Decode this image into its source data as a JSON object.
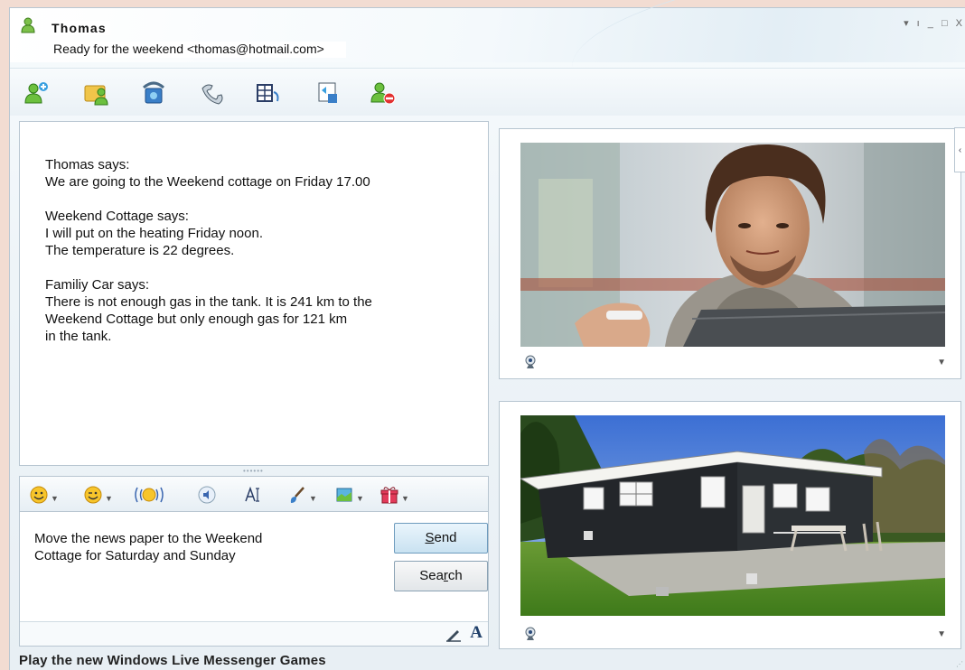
{
  "header": {
    "user_name": "Thomas",
    "status_line": "Ready for the weekend <thomas@hotmail.com>",
    "window_controls": "▾ ı _ □ X"
  },
  "toolbar": {
    "icons": [
      "add-contact-icon",
      "invite-icon",
      "call-icon",
      "phone-icon",
      "video-clip-icon",
      "share-folder-icon",
      "block-icon"
    ]
  },
  "conversation": {
    "messages": [
      {
        "sender": "Thomas says:",
        "text": "We are going to the Weekend cottage on Friday 17.00"
      },
      {
        "sender": "Weekend Cottage says:",
        "text": "I will put on the heating Friday noon.\nThe temperature is 22 degrees."
      },
      {
        "sender": "Familiy Car says:",
        "text": "There is not enough gas in the tank. It is 241 km to the\nWeekend Cottage but only enough gas for 121 km\nin the tank."
      }
    ]
  },
  "emoji_bar": {
    "icons": [
      "emoticon-icon",
      "wink-icon",
      "nudge-icon",
      "voice-clip-icon",
      "font-style-icon",
      "paint-icon",
      "background-icon",
      "gift-icon"
    ]
  },
  "compose": {
    "text": "Move the news paper to the Weekend\nCottage for Saturday and Sunday",
    "send_label_pre": "",
    "send_label_key": "S",
    "send_label_post": "end",
    "search_label_pre": "Sea",
    "search_label_key": "r",
    "search_label_post": "ch",
    "font_label": "A"
  },
  "status_bar": {
    "text": "Play the new Windows Live Messenger Games"
  },
  "colors": {
    "accent": "#6d9bbd",
    "background": "#f2dcd2"
  }
}
